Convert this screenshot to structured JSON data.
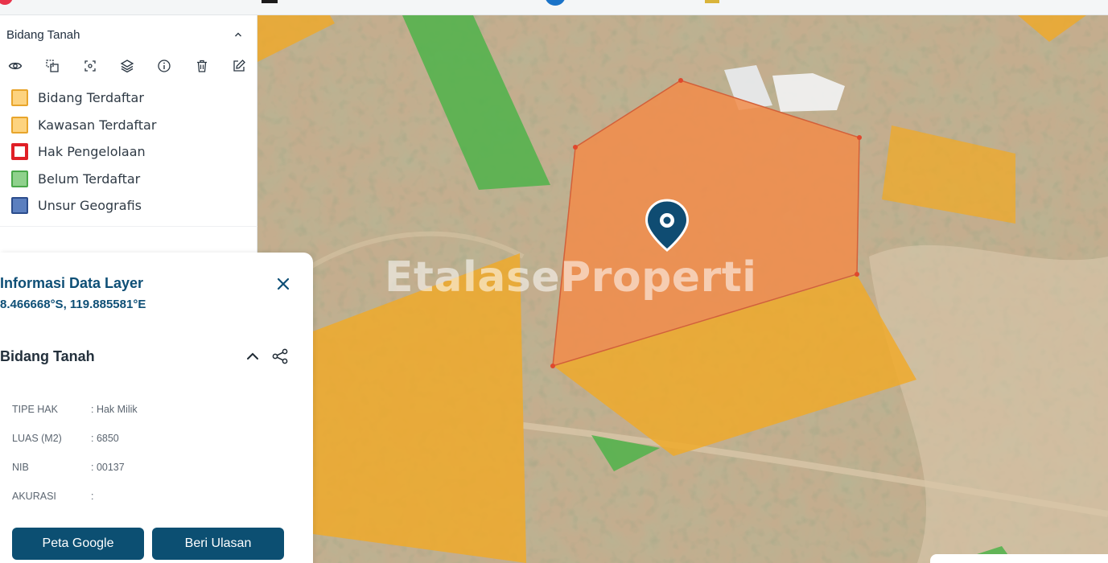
{
  "layer_panel": {
    "title": "Bidang Tanah",
    "tools": [
      "eye-icon",
      "copy-frame-icon",
      "focus-icon",
      "layers-icon",
      "info-icon",
      "trash-icon",
      "edit-icon"
    ],
    "legend": [
      {
        "label": "Bidang Terdaftar",
        "fill": "#fdd37f",
        "border": "#e8a52c"
      },
      {
        "label": "Kawasan Terdaftar",
        "fill": "#fdd37f",
        "border": "#e8a52c"
      },
      {
        "label": "Hak Pengelolaan",
        "fill": "#ffffff",
        "border": "#e01f26"
      },
      {
        "label": "Belum Terdaftar",
        "fill": "#8fd18c",
        "border": "#4aa84a"
      },
      {
        "label": "Unsur Geografis",
        "fill": "#5b7fbf",
        "border": "#2c4d8c"
      }
    ]
  },
  "map": {
    "watermark": "EtalaseProperti",
    "colors": {
      "registered": "#f0a927",
      "selected": "#f28c4a",
      "unregistered": "#4fb34a",
      "selected_border": "#d2603a"
    }
  },
  "info": {
    "title": "Informasi Data Layer",
    "coords": "8.466668°S, 119.885581°E",
    "section": "Bidang Tanah",
    "attributes": [
      {
        "key": "TIPE HAK",
        "value": ": Hak Milik"
      },
      {
        "key": "LUAS (M2)",
        "value": ": 6850"
      },
      {
        "key": "NIB",
        "value": ": 00137"
      },
      {
        "key": "AKURASI",
        "value": ":"
      }
    ],
    "buttons": {
      "google": "Peta Google",
      "review": "Beri Ulasan"
    }
  }
}
